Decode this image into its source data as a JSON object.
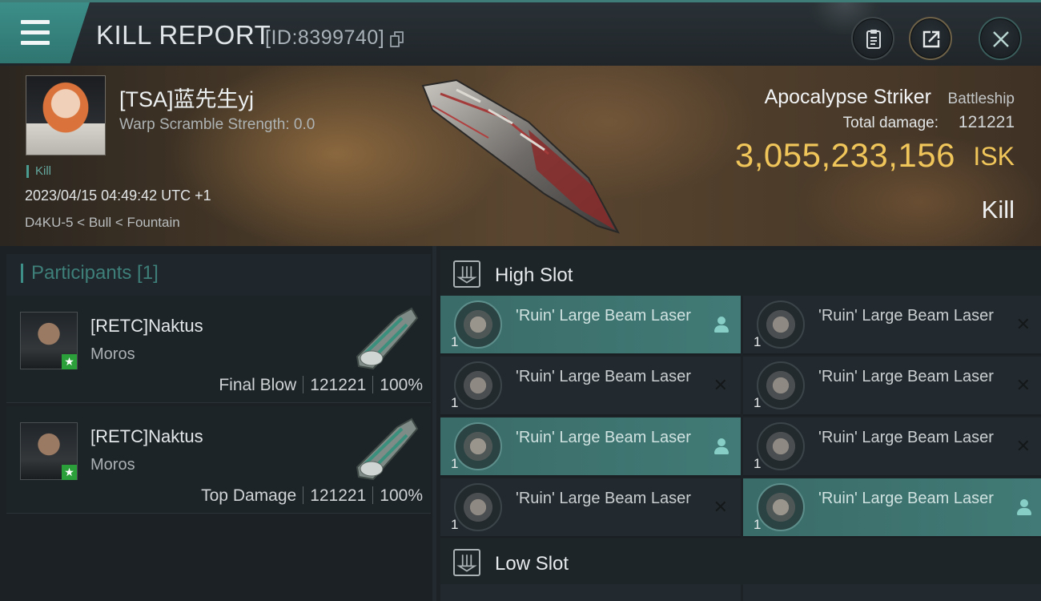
{
  "header": {
    "title": "KILL REPORT",
    "report_id": "[ID:8399740]"
  },
  "victim": {
    "name": "[TSA]蓝先生yj",
    "scramble": "Warp Scramble Strength: 0.0",
    "kill_tag": "Kill",
    "timestamp": "2023/04/15 04:49:42 UTC +1",
    "location": "D4KU-5 < Bull < Fountain",
    "ship_name": "Apocalypse Striker",
    "ship_class": "Battleship",
    "damage_label": "Total damage:",
    "damage_value": "121221",
    "isk_value": "3,055,233,156",
    "isk_unit": "ISK",
    "result": "Kill"
  },
  "participants": {
    "header": "Participants [1]",
    "items": [
      {
        "name": "[RETC]Naktus",
        "ship": "Moros",
        "role": "Final Blow",
        "damage": "121221",
        "percent": "100%"
      },
      {
        "name": "[RETC]Naktus",
        "ship": "Moros",
        "role": "Top Damage",
        "damage": "121221",
        "percent": "100%"
      }
    ]
  },
  "fitting": {
    "high_slot_label": "High Slot",
    "low_slot_label": "Low Slot",
    "high_modules": [
      {
        "name": "'Ruin' Large Beam Laser",
        "qty": "1",
        "status": "retained"
      },
      {
        "name": "'Ruin' Large Beam Laser",
        "qty": "1",
        "status": "destroyed"
      },
      {
        "name": "'Ruin' Large Beam Laser",
        "qty": "1",
        "status": "destroyed"
      },
      {
        "name": "'Ruin' Large Beam Laser",
        "qty": "1",
        "status": "destroyed"
      },
      {
        "name": "'Ruin' Large Beam Laser",
        "qty": "1",
        "status": "retained"
      },
      {
        "name": "'Ruin' Large Beam Laser",
        "qty": "1",
        "status": "destroyed"
      },
      {
        "name": "'Ruin' Large Beam Laser",
        "qty": "1",
        "status": "destroyed"
      },
      {
        "name": "'Ruin' Large Beam Laser",
        "qty": "1",
        "status": "retained"
      }
    ],
    "destroyed_mark": "✕"
  },
  "icons": {
    "menu": "hamburger-icon",
    "copy": "copy-icon",
    "clipboard": "clipboard-icon",
    "share": "share-icon",
    "close": "close-icon",
    "slot": "high-slot-icon",
    "pilot": "pilot-icon"
  },
  "colors": {
    "accent": "#3c8e89",
    "isk": "#f0c55a",
    "highlight_row": "#3a6c69"
  }
}
